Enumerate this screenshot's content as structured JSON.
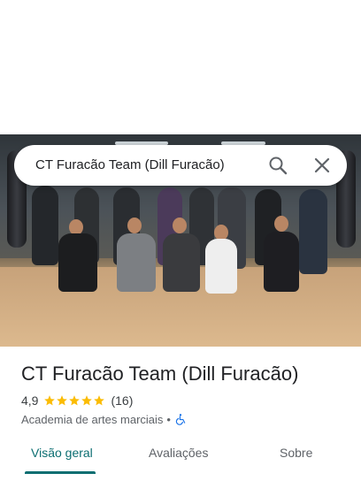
{
  "search": {
    "query": "CT Furacão Team (Dill Furacão)",
    "search_icon": "search-icon",
    "close_icon": "close-icon"
  },
  "place": {
    "name": "CT Furacão Team (Dill Furacão)",
    "rating": "4,9",
    "stars": 5,
    "reviews_count": "(16)",
    "category": "Academia de artes marciais",
    "separator": "•",
    "accessibility_icon": "wheelchair-icon"
  },
  "tabs": [
    {
      "label": "Visão geral",
      "active": true
    },
    {
      "label": "Avaliações",
      "active": false
    },
    {
      "label": "Sobre",
      "active": false
    }
  ],
  "colors": {
    "accent": "#0b6e71",
    "star": "#fbbc04",
    "accessibility": "#1a73e8"
  }
}
